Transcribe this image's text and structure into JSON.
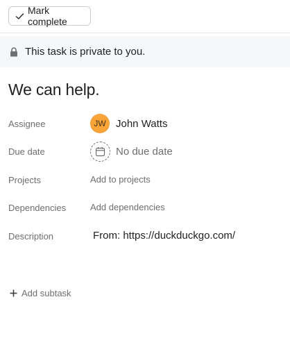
{
  "toolbar": {
    "mark_complete_label": "Mark complete",
    "icon": "check-icon"
  },
  "banner": {
    "icon": "lock-icon",
    "text": "This task is private to you."
  },
  "task": {
    "title": "We can help."
  },
  "fields": {
    "assignee": {
      "label": "Assignee",
      "avatar_initials": "JW",
      "avatar_color": "#f9a53a",
      "name": "John Watts"
    },
    "due_date": {
      "label": "Due date",
      "icon": "calendar-icon",
      "value": "No due date"
    },
    "projects": {
      "label": "Projects",
      "value": "Add to projects"
    },
    "dependencies": {
      "label": "Dependencies",
      "value": "Add dependencies"
    },
    "description": {
      "label": "Description",
      "value": "From: https://duckduckgo.com/"
    }
  },
  "subtask": {
    "icon": "plus-icon",
    "label": "Add subtask"
  }
}
